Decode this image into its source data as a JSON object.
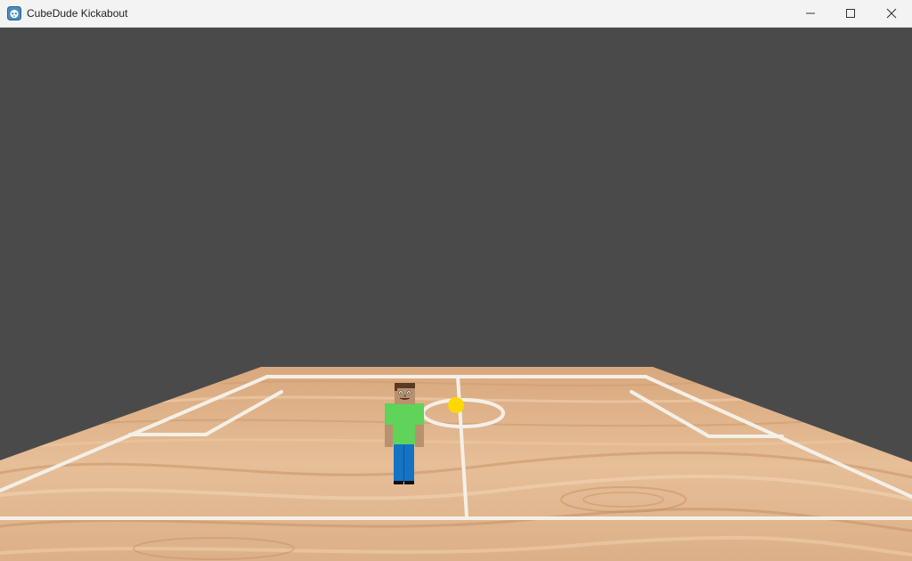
{
  "window": {
    "title": "CubeDude Kickabout",
    "controls": {
      "minimize": "minimize-icon",
      "maximize": "maximize-icon",
      "close": "close-icon"
    }
  },
  "scene": {
    "sky_color": "#4a4a4a",
    "floor_color": "#e0b48c",
    "line_color": "#f4f0e8",
    "ball_color": "#ffd800",
    "player": {
      "shirt_color": "#5fd35a",
      "pants_color": "#1473c4",
      "skin_color": "#b9916f",
      "hair_color": "#5a3a22"
    }
  }
}
